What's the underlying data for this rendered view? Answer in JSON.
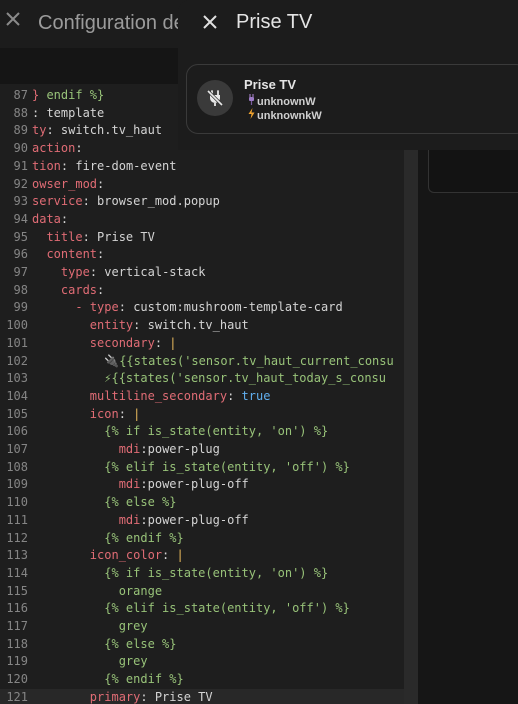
{
  "background_dialog": {
    "title": "Configuration de",
    "close_icon": "close-icon"
  },
  "popup": {
    "title": "Prise TV",
    "close_icon": "close-icon",
    "card": {
      "icon": "power-plug-off-icon",
      "primary": "Prise TV",
      "secondary_line1": "unknownW",
      "secondary_line2": "unknownkW",
      "line1_icon": "plug-emoji-icon",
      "line2_icon": "lightning-emoji-icon"
    }
  },
  "editor": {
    "lines": [
      {
        "n": "87",
        "text": "} endif %}"
      },
      {
        "n": "88",
        "text": ": template"
      },
      {
        "n": "89",
        "text": "ty: switch.tv_haut"
      },
      {
        "n": "90",
        "text": "action:"
      },
      {
        "n": "91",
        "text": "tion: fire-dom-event"
      },
      {
        "n": "92",
        "text": "owser_mod:"
      },
      {
        "n": "93",
        "text": "service: browser_mod.popup"
      },
      {
        "n": "94",
        "text": "data:"
      },
      {
        "n": "95",
        "text": "  title: Prise TV"
      },
      {
        "n": "96",
        "text": "  content:"
      },
      {
        "n": "97",
        "text": "    type: vertical-stack"
      },
      {
        "n": "98",
        "text": "    cards:"
      },
      {
        "n": "99",
        "text": "      - type: custom:mushroom-template-card"
      },
      {
        "n": "100",
        "text": "        entity: switch.tv_haut"
      },
      {
        "n": "101",
        "text": "        secondary: |"
      },
      {
        "n": "102",
        "text": "          🔌{{states('sensor.tv_haut_current_consu"
      },
      {
        "n": "103",
        "text": "          ⚡{{states('sensor.tv_haut_today_s_consu"
      },
      {
        "n": "104",
        "text": "        multiline_secondary: true"
      },
      {
        "n": "105",
        "text": "        icon: |"
      },
      {
        "n": "106",
        "text": "          {% if is_state(entity, 'on') %}"
      },
      {
        "n": "107",
        "text": "            mdi:power-plug"
      },
      {
        "n": "108",
        "text": "          {% elif is_state(entity, 'off') %}"
      },
      {
        "n": "109",
        "text": "            mdi:power-plug-off"
      },
      {
        "n": "110",
        "text": "          {% else %}"
      },
      {
        "n": "111",
        "text": "            mdi:power-plug-off"
      },
      {
        "n": "112",
        "text": "          {% endif %}"
      },
      {
        "n": "113",
        "text": "        icon_color: |"
      },
      {
        "n": "114",
        "text": "          {% if is_state(entity, 'on') %}"
      },
      {
        "n": "115",
        "text": "            orange"
      },
      {
        "n": "116",
        "text": "          {% elif is_state(entity, 'off') %}"
      },
      {
        "n": "117",
        "text": "            grey"
      },
      {
        "n": "118",
        "text": "          {% else %}"
      },
      {
        "n": "119",
        "text": "            grey"
      },
      {
        "n": "120",
        "text": "          {% endif %}"
      },
      {
        "n": "121",
        "text": "        primary: Prise TV"
      }
    ]
  }
}
